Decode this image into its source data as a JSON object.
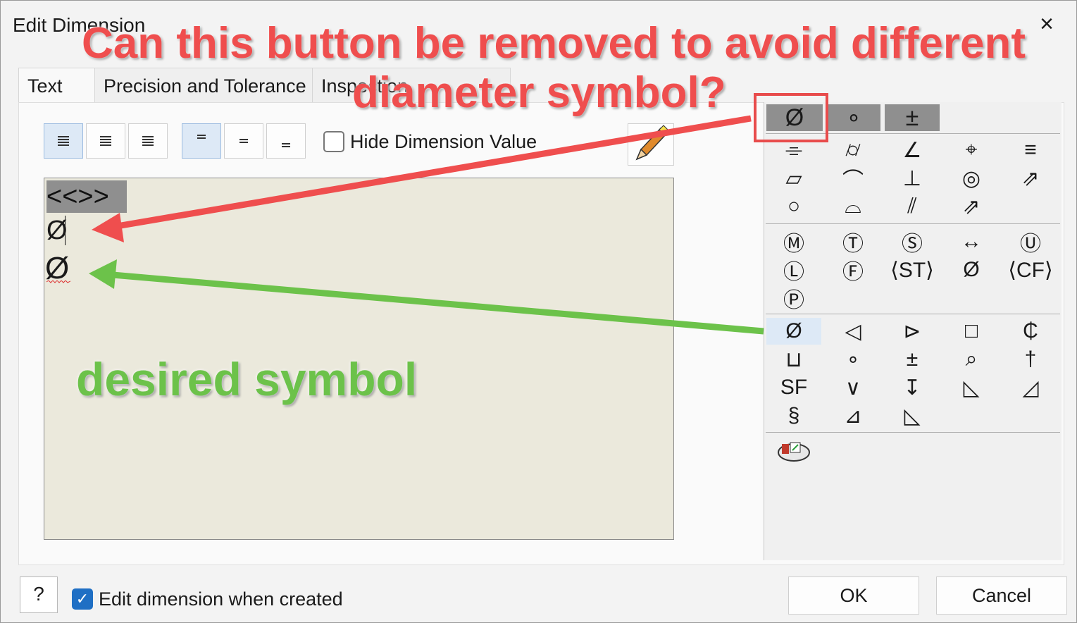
{
  "window": {
    "title": "Edit Dimension",
    "close_icon": "close-icon"
  },
  "tabs": [
    {
      "label": "Text"
    },
    {
      "label": "Precision and Tolerance"
    },
    {
      "label": "Inspection Dimension"
    }
  ],
  "toolbar": {
    "hide_value_label": "Hide Dimension Value",
    "hide_value_checked": false
  },
  "editor": {
    "placeholder_text": "<<>>",
    "line2": "Ø",
    "line3": "Ø"
  },
  "palette": {
    "tabs": [
      "Ø",
      "∘",
      "±"
    ],
    "row_a": [
      "⌯",
      "⌭",
      "∠",
      "⌖",
      "≡"
    ],
    "row_b": [
      "▱",
      "⌒",
      "⊥",
      "◎",
      "⇗"
    ],
    "row_c": [
      "○",
      "⌓",
      "⫽",
      "⇗",
      ""
    ],
    "row_d": [
      "Ⓜ",
      "Ⓣ",
      "Ⓢ",
      "↔",
      "Ⓤ"
    ],
    "row_e": [
      "Ⓛ",
      "Ⓕ",
      "⟨ST⟩",
      "Ø",
      "⟨CF⟩"
    ],
    "row_f": [
      "Ⓟ",
      "",
      "",
      "",
      ""
    ],
    "row_g": [
      "Ø",
      "◁",
      "⊳",
      "□",
      "₵"
    ],
    "row_h": [
      "⊔",
      "∘",
      "±",
      "⌕",
      "†"
    ],
    "row_i": [
      "SF",
      "∨",
      "↧",
      "◺",
      "◿"
    ],
    "row_j": [
      "§",
      "⊿",
      "◺",
      "",
      ""
    ]
  },
  "footer": {
    "edit_when_created_label": "Edit dimension when created",
    "edit_when_created_checked": true,
    "ok_label": "OK",
    "cancel_label": "Cancel",
    "help_label": "?"
  },
  "annotations": {
    "question_line1": "Can this button be removed to avoid different",
    "question_line2": "diameter symbol?",
    "desired": "desired symbol"
  },
  "colors": {
    "annotation_red": "#ef4e4e",
    "annotation_green": "#6cc24a",
    "selected_blue": "#dde9f6",
    "accent": "#1f6fc4"
  }
}
